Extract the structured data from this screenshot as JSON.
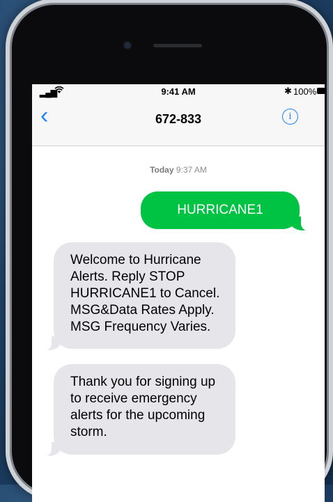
{
  "status": {
    "time": "9:41 AM",
    "battery_pct": "100%",
    "bluetooth_icon": "bluetooth-icon",
    "wifi_icon": "wifi-icon",
    "signal_icon": "cellular-signal-icon"
  },
  "nav": {
    "back_glyph": "‹",
    "title": "672-833",
    "info_glyph": "i"
  },
  "conversation": {
    "date_label": "Today",
    "time_label": "9:37 AM",
    "messages": [
      {
        "direction": "sent",
        "text": "HURRICANE1"
      },
      {
        "direction": "received",
        "lines": [
          "Welcome to Hurricane",
          "Alerts. Reply STOP",
          "HURRICANE1 to Cancel.",
          "MSG&Data Rates Apply.",
          "MSG Frequency Varies."
        ]
      },
      {
        "direction": "received",
        "lines": [
          "Thank you for signing up",
          "to receive emergency",
          "alerts for the upcoming",
          "storm."
        ]
      }
    ]
  },
  "colors": {
    "sent_bubble": "#00c243",
    "received_bubble": "#e5e5ea",
    "accent": "#1a84ff"
  }
}
